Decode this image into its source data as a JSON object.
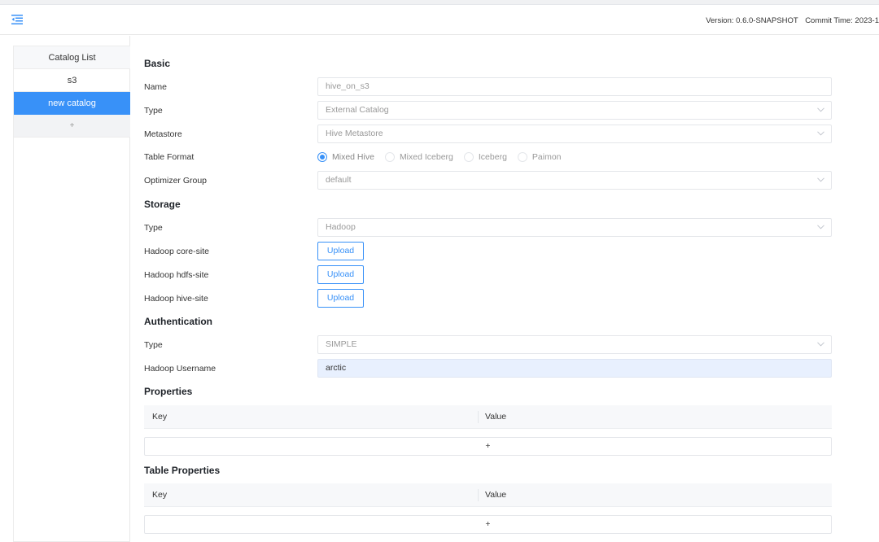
{
  "header": {
    "version": "Version: 0.6.0-SNAPSHOT",
    "commit_time": "Commit Time: 2023-1"
  },
  "sidebar": {
    "title": "Catalog List",
    "items": [
      {
        "label": "s3",
        "active": false
      },
      {
        "label": "new catalog",
        "active": true
      }
    ],
    "add_label": "+"
  },
  "sections": {
    "basic": "Basic",
    "storage": "Storage",
    "authentication": "Authentication",
    "properties": "Properties",
    "table_properties": "Table Properties"
  },
  "basic": {
    "name_label": "Name",
    "name_placeholder": "hive_on_s3",
    "type_label": "Type",
    "type_value": "External Catalog",
    "metastore_label": "Metastore",
    "metastore_value": "Hive Metastore",
    "table_format_label": "Table Format",
    "table_formats": [
      {
        "label": "Mixed Hive",
        "checked": true
      },
      {
        "label": "Mixed Iceberg",
        "checked": false
      },
      {
        "label": "Iceberg",
        "checked": false
      },
      {
        "label": "Paimon",
        "checked": false
      }
    ],
    "optimizer_group_label": "Optimizer Group",
    "optimizer_group_value": "default"
  },
  "storage": {
    "type_label": "Type",
    "type_value": "Hadoop",
    "core_site_label": "Hadoop core-site",
    "hdfs_site_label": "Hadoop hdfs-site",
    "hive_site_label": "Hadoop hive-site",
    "upload_label": "Upload"
  },
  "authentication": {
    "type_label": "Type",
    "type_value": "SIMPLE",
    "username_label": "Hadoop Username",
    "username_value": "arctic"
  },
  "properties": {
    "key_header": "Key",
    "value_header": "Value",
    "add_label": "+"
  },
  "table_properties": {
    "key_header": "Key",
    "value_header": "Value",
    "add_label": "+"
  },
  "colors": {
    "primary": "#3891f8",
    "border": "#e4e6ea",
    "filled_input": "#e8f0fe"
  }
}
